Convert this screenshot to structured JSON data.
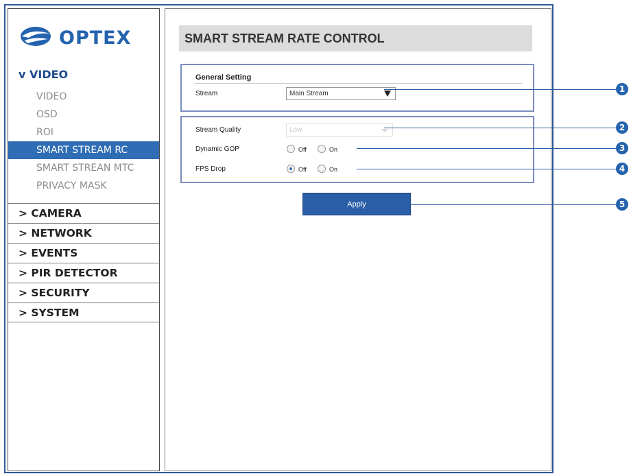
{
  "logo": {
    "text": "OPTEX"
  },
  "sidebar": {
    "video_header": "v VIDEO",
    "sub_items": [
      {
        "label": "VIDEO",
        "active": false
      },
      {
        "label": "OSD",
        "active": false
      },
      {
        "label": "ROI",
        "active": false
      },
      {
        "label": "SMART STREAM RC",
        "active": true
      },
      {
        "label": "SMART STREAN MTC",
        "active": false
      },
      {
        "label": "PRIVACY MASK",
        "active": false
      }
    ],
    "main_items": [
      {
        "label": "> CAMERA"
      },
      {
        "label": "> NETWORK"
      },
      {
        "label": "> EVENTS"
      },
      {
        "label": "> PIR DETECTOR"
      },
      {
        "label": "> SECURITY"
      },
      {
        "label": "> SYSTEM"
      }
    ]
  },
  "page": {
    "title": "SMART STREAM RATE CONTROL",
    "general_setting": {
      "heading": "General Setting",
      "stream_label": "Stream",
      "stream_value": "Main Stream"
    },
    "stream_quality": {
      "label": "Stream Quality",
      "value": "Low",
      "disabled": true
    },
    "dynamic_gop": {
      "label": "Dynamic GOP",
      "off_label": "Off",
      "on_label": "On",
      "selected": "none"
    },
    "fps_drop": {
      "label": "FPS Drop",
      "off_label": "Off",
      "on_label": "On",
      "selected": "Off"
    },
    "apply_label": "Apply"
  },
  "callouts": [
    "1",
    "2",
    "3",
    "4",
    "5"
  ],
  "colors": {
    "accent": "#2f6db5",
    "frame": "#2f5a93",
    "callout": "#2463ae"
  }
}
